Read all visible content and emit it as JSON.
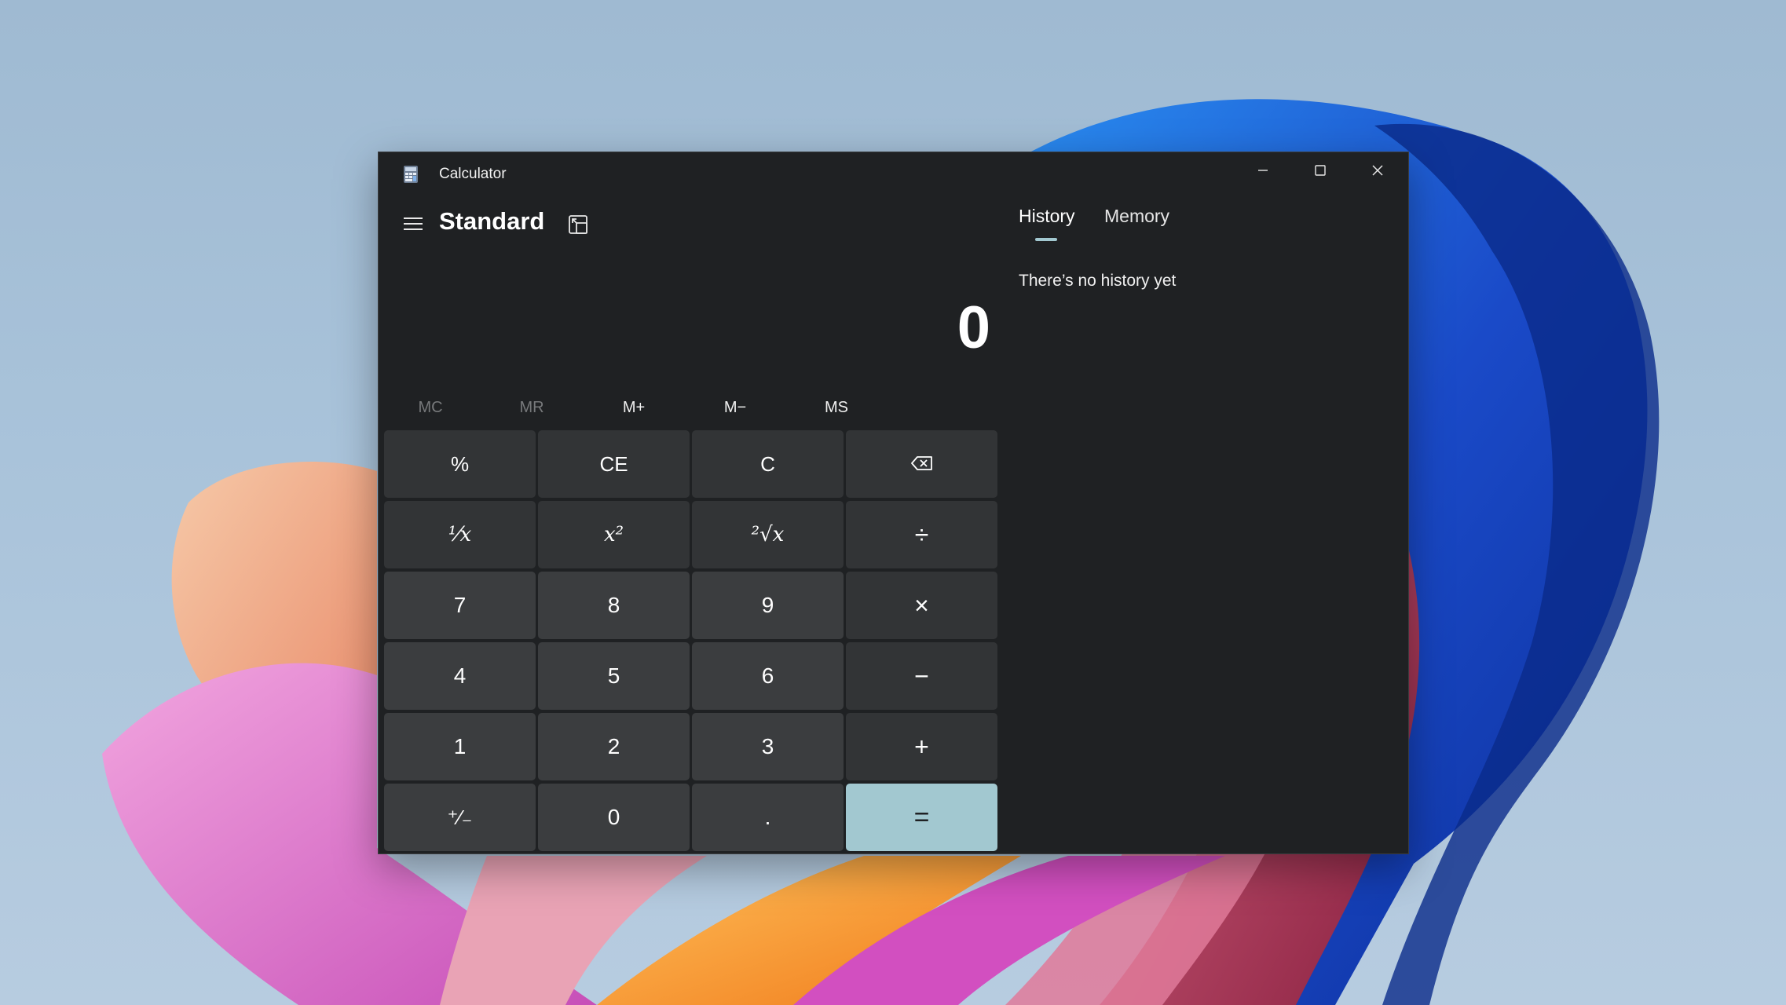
{
  "window": {
    "title": "Calculator",
    "icon": "calculator-icon",
    "controls": [
      "minimize-icon",
      "maximize-icon",
      "close-icon"
    ]
  },
  "header": {
    "menu_icon": "hamburger-icon",
    "mode": "Standard",
    "keep_on_top_icon": "keep-on-top-icon"
  },
  "display": {
    "value": "0"
  },
  "memory": {
    "buttons": [
      {
        "label": "MC",
        "enabled": false
      },
      {
        "label": "MR",
        "enabled": false
      },
      {
        "label": "M+",
        "enabled": true
      },
      {
        "label": "M−",
        "enabled": true
      },
      {
        "label": "MS",
        "enabled": true
      }
    ]
  },
  "keys": {
    "percent": "%",
    "ce": "CE",
    "c": "C",
    "backspace_icon": "backspace-icon",
    "reciprocal": "¹⁄x",
    "square": "x²",
    "sqrt": "²√x",
    "divide": "÷",
    "seven": "7",
    "eight": "8",
    "nine": "9",
    "multiply": "×",
    "four": "4",
    "five": "5",
    "six": "6",
    "minus": "−",
    "one": "1",
    "two": "2",
    "three": "3",
    "plus": "+",
    "negate": "⁺⁄₋",
    "zero": "0",
    "decimal": ".",
    "equals": "="
  },
  "side_panel": {
    "tabs": [
      {
        "label": "History",
        "active": true
      },
      {
        "label": "Memory",
        "active": false
      }
    ],
    "empty_message": "There’s no history yet"
  },
  "colors": {
    "window_bg": "#1f2123",
    "key_bg": "#3b3d3f",
    "accent": "#a2c8d0"
  }
}
